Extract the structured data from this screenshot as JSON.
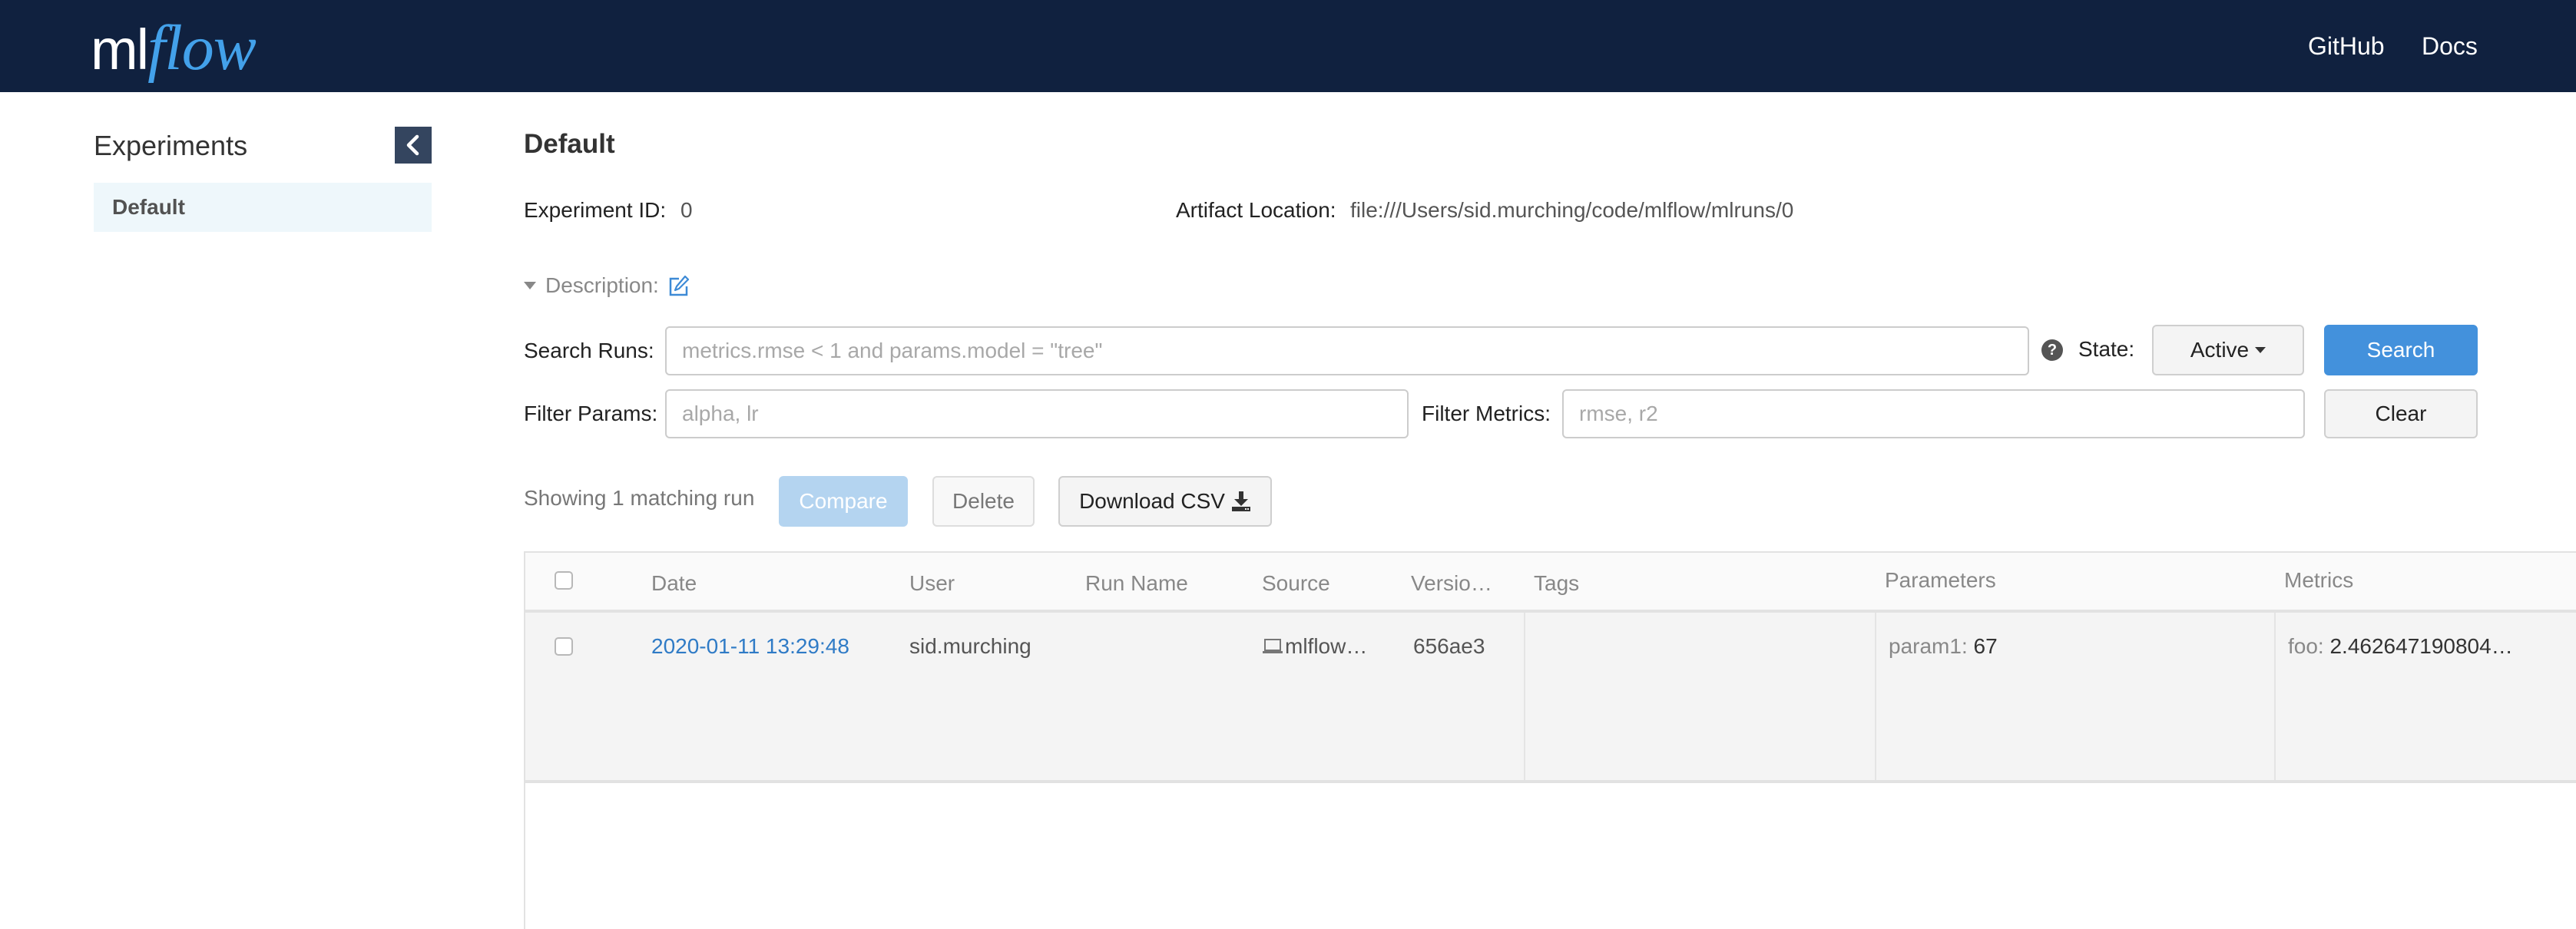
{
  "header": {
    "logo": {
      "ml": "ml",
      "flow": "flow"
    },
    "links": [
      {
        "label": "GitHub"
      },
      {
        "label": "Docs"
      }
    ]
  },
  "sidebar": {
    "title": "Experiments",
    "toggle_icon": "chevron-left-icon",
    "items": [
      {
        "label": "Default",
        "selected": true
      }
    ]
  },
  "experiment": {
    "title": "Default",
    "id_label": "Experiment ID:",
    "id_value": "0",
    "artifact_label": "Artifact Location:",
    "artifact_value": "file:///Users/sid.murching/code/mlflow/mlruns/0",
    "description_label": "Description:"
  },
  "search": {
    "search_label": "Search Runs:",
    "search_placeholder": "metrics.rmse < 1 and params.model = \"tree\"",
    "search_value": "",
    "help_glyph": "?",
    "state_label": "State:",
    "state_value": "Active",
    "search_button": "Search",
    "params_label": "Filter Params:",
    "params_placeholder": "alpha, lr",
    "params_value": "",
    "metrics_label": "Filter Metrics:",
    "metrics_placeholder": "rmse, r2",
    "metrics_value": "",
    "clear_button": "Clear"
  },
  "actions": {
    "count_text": "Showing 1 matching run",
    "compare": "Compare",
    "delete": "Delete",
    "download": "Download CSV"
  },
  "colors": {
    "header_bg": "#10213f",
    "primary": "#4391dc",
    "link": "#2f7bc6"
  },
  "table": {
    "columns": [
      "Date",
      "User",
      "Run Name",
      "Source",
      "Versio…",
      "Tags",
      "Parameters",
      "Metrics"
    ],
    "rows": [
      {
        "date": "2020-01-11 13:29:48",
        "user": "sid.murching",
        "run_name": "",
        "source": "mlflow…",
        "version": "656ae3",
        "tags": "",
        "params": [
          {
            "key": "param1:",
            "value": "67"
          }
        ],
        "metrics": [
          {
            "key": "foo:",
            "value": "2.462647190804…"
          }
        ]
      }
    ]
  }
}
